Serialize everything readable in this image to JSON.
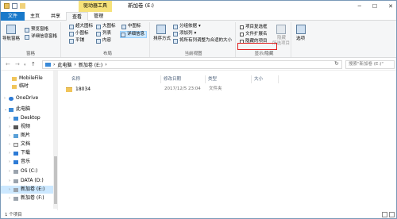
{
  "title_bar": {
    "context_tab": "驱动器工具",
    "window_title": "新加卷 (E:)",
    "min": "─",
    "max": "☐",
    "close": "✕"
  },
  "tabs": [
    {
      "label": "文件"
    },
    {
      "label": "主页"
    },
    {
      "label": "共享"
    },
    {
      "label": "查看"
    },
    {
      "label": "管理"
    }
  ],
  "ribbon": {
    "panes": {
      "nav_pane": "导航窗格",
      "preview": "预览窗格",
      "details": "详细信息窗格",
      "group": "窗格"
    },
    "layout": {
      "xl_icons": "超大图标",
      "l_icons": "大图标",
      "m_icons": "中图标",
      "s_icons": "小图标",
      "list": "列表",
      "details": "详细信息",
      "tiles": "平铺",
      "content": "内容",
      "group": "布局"
    },
    "current_view": {
      "sort_by": "排序方式",
      "group_by": "分组依据",
      "add_columns": "添加列",
      "size_columns": "将所有列调整为合适的大小",
      "group": "当前视图"
    },
    "show_hide": {
      "item_checkboxes": "项目复选框",
      "file_extensions": "文件扩展名",
      "hidden_items": "隐藏的项目",
      "hide_selected_l1": "隐藏",
      "hide_selected_l2": "所选项目",
      "group": "显示/隐藏"
    },
    "options": "选项"
  },
  "address": {
    "path": [
      "此电脑",
      "新加卷 (E:)"
    ],
    "search_placeholder": "搜索\"新加卷 (E:)\""
  },
  "nav_items": [
    {
      "label": "MobileFile"
    },
    {
      "label": "临时"
    },
    {
      "label": "OneDrive"
    },
    {
      "label": "此电脑"
    },
    {
      "label": "Desktop"
    },
    {
      "label": "视频"
    },
    {
      "label": "图片"
    },
    {
      "label": "文档"
    },
    {
      "label": "下载"
    },
    {
      "label": "音乐"
    },
    {
      "label": "OS (C:)"
    },
    {
      "label": "DATA (D:)"
    },
    {
      "label": "新加卷 (E:)"
    },
    {
      "label": "新加卷 (F:)"
    }
  ],
  "columns": {
    "name": "名称",
    "date": "修改日期",
    "type": "类型",
    "size": "大小"
  },
  "files": [
    {
      "name": "18034",
      "date": "2017/12/5 23:04",
      "type": "文件夹",
      "size": ""
    }
  ],
  "status": {
    "count": "1 个项目"
  },
  "colors": {
    "file_tab": "#1979ca",
    "context_tab": "#f6e27a",
    "selection": "#cce8ff",
    "highlight_box": "#e02020"
  }
}
